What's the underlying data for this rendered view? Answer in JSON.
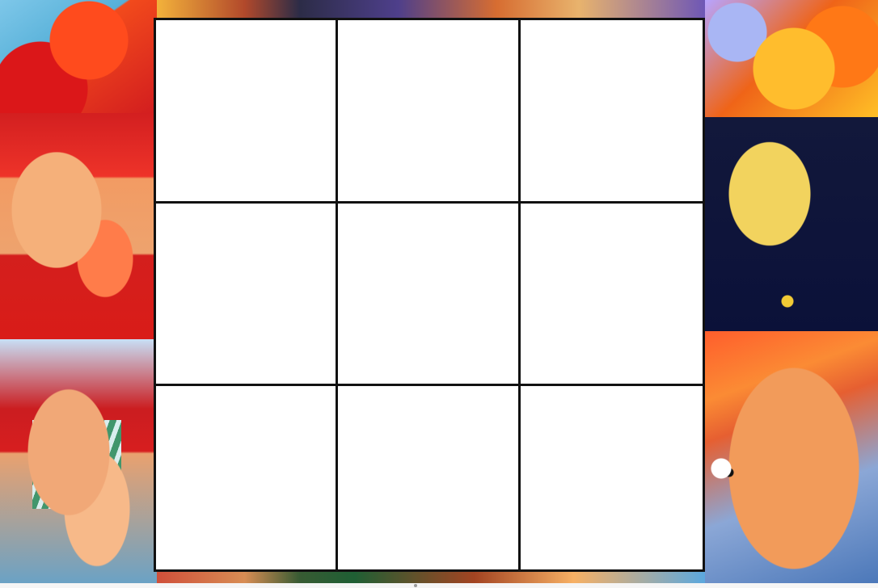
{
  "background": {
    "theme": "anime-collage",
    "accent_colors": [
      "#db1719",
      "#f5b07a",
      "#0b1139",
      "#f2ca35",
      "#4976b8",
      "#41966c"
    ]
  },
  "board": {
    "rows": 3,
    "cols": 3,
    "cells": [
      "",
      "",
      "",
      "",
      "",
      "",
      "",
      "",
      ""
    ]
  }
}
